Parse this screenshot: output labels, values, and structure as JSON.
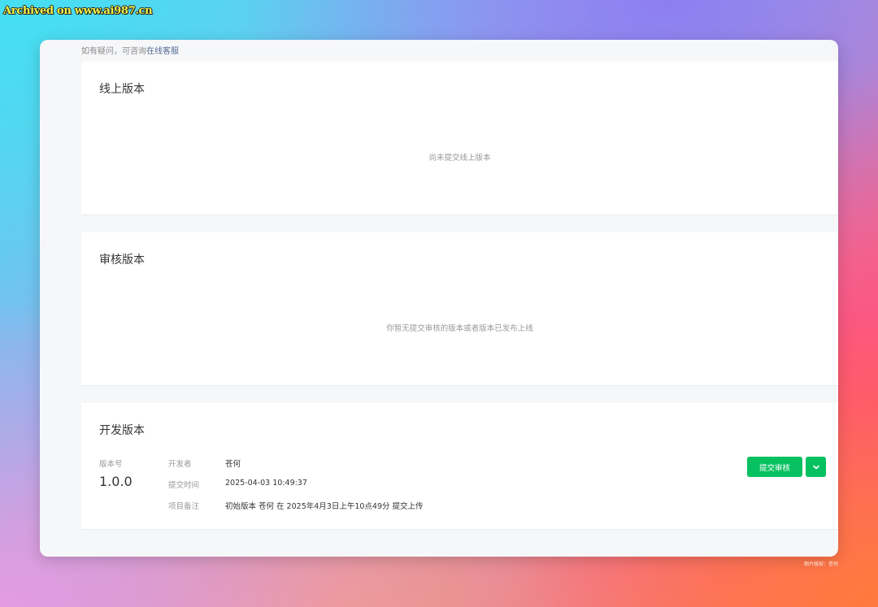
{
  "watermark": "Archived on www.ai987.cn",
  "credit": "图片版权：苍何",
  "help": {
    "prefix": "如有疑问，可咨询",
    "link": "在线客服"
  },
  "online_version": {
    "title": "线上版本",
    "empty_text": "尚未提交线上版本"
  },
  "review_version": {
    "title": "审核版本",
    "empty_text": "你暂无提交审核的版本或者版本已发布上线"
  },
  "dev_version": {
    "title": "开发版本",
    "version_label": "版本号",
    "version_value": "1.0.0",
    "developer_label": "开发者",
    "developer_value": "苍何",
    "submit_time_label": "提交时间",
    "submit_time_value": "2025-04-03 10:49:37",
    "remark_label": "项目备注",
    "remark_value": "初始版本 苍何 在 2025年4月3日上午10点49分 提交上传",
    "submit_button": "提交审核",
    "more_icon": "chevron-down-icon"
  },
  "colors": {
    "primary_green": "#07c160",
    "link_blue": "#576b95"
  }
}
